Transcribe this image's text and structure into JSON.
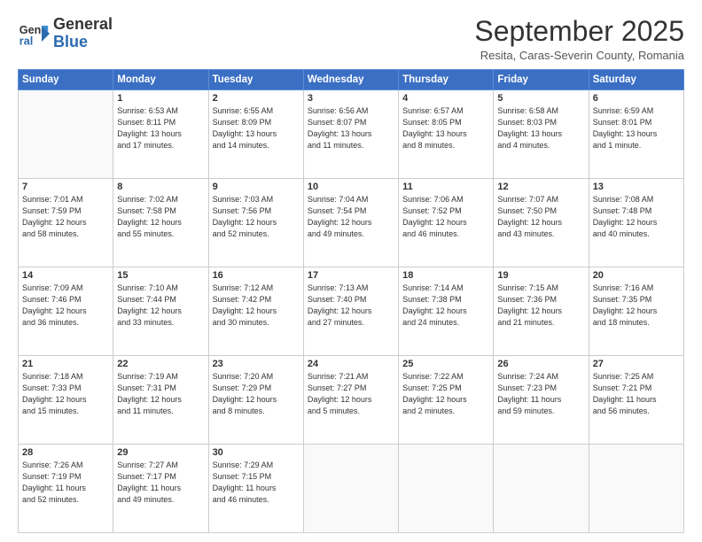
{
  "header": {
    "logo_general": "General",
    "logo_blue": "Blue",
    "month_title": "September 2025",
    "subtitle": "Resita, Caras-Severin County, Romania"
  },
  "days_of_week": [
    "Sunday",
    "Monday",
    "Tuesday",
    "Wednesday",
    "Thursday",
    "Friday",
    "Saturday"
  ],
  "weeks": [
    [
      {
        "day": "",
        "info": ""
      },
      {
        "day": "1",
        "info": "Sunrise: 6:53 AM\nSunset: 8:11 PM\nDaylight: 13 hours\nand 17 minutes."
      },
      {
        "day": "2",
        "info": "Sunrise: 6:55 AM\nSunset: 8:09 PM\nDaylight: 13 hours\nand 14 minutes."
      },
      {
        "day": "3",
        "info": "Sunrise: 6:56 AM\nSunset: 8:07 PM\nDaylight: 13 hours\nand 11 minutes."
      },
      {
        "day": "4",
        "info": "Sunrise: 6:57 AM\nSunset: 8:05 PM\nDaylight: 13 hours\nand 8 minutes."
      },
      {
        "day": "5",
        "info": "Sunrise: 6:58 AM\nSunset: 8:03 PM\nDaylight: 13 hours\nand 4 minutes."
      },
      {
        "day": "6",
        "info": "Sunrise: 6:59 AM\nSunset: 8:01 PM\nDaylight: 13 hours\nand 1 minute."
      }
    ],
    [
      {
        "day": "7",
        "info": "Sunrise: 7:01 AM\nSunset: 7:59 PM\nDaylight: 12 hours\nand 58 minutes."
      },
      {
        "day": "8",
        "info": "Sunrise: 7:02 AM\nSunset: 7:58 PM\nDaylight: 12 hours\nand 55 minutes."
      },
      {
        "day": "9",
        "info": "Sunrise: 7:03 AM\nSunset: 7:56 PM\nDaylight: 12 hours\nand 52 minutes."
      },
      {
        "day": "10",
        "info": "Sunrise: 7:04 AM\nSunset: 7:54 PM\nDaylight: 12 hours\nand 49 minutes."
      },
      {
        "day": "11",
        "info": "Sunrise: 7:06 AM\nSunset: 7:52 PM\nDaylight: 12 hours\nand 46 minutes."
      },
      {
        "day": "12",
        "info": "Sunrise: 7:07 AM\nSunset: 7:50 PM\nDaylight: 12 hours\nand 43 minutes."
      },
      {
        "day": "13",
        "info": "Sunrise: 7:08 AM\nSunset: 7:48 PM\nDaylight: 12 hours\nand 40 minutes."
      }
    ],
    [
      {
        "day": "14",
        "info": "Sunrise: 7:09 AM\nSunset: 7:46 PM\nDaylight: 12 hours\nand 36 minutes."
      },
      {
        "day": "15",
        "info": "Sunrise: 7:10 AM\nSunset: 7:44 PM\nDaylight: 12 hours\nand 33 minutes."
      },
      {
        "day": "16",
        "info": "Sunrise: 7:12 AM\nSunset: 7:42 PM\nDaylight: 12 hours\nand 30 minutes."
      },
      {
        "day": "17",
        "info": "Sunrise: 7:13 AM\nSunset: 7:40 PM\nDaylight: 12 hours\nand 27 minutes."
      },
      {
        "day": "18",
        "info": "Sunrise: 7:14 AM\nSunset: 7:38 PM\nDaylight: 12 hours\nand 24 minutes."
      },
      {
        "day": "19",
        "info": "Sunrise: 7:15 AM\nSunset: 7:36 PM\nDaylight: 12 hours\nand 21 minutes."
      },
      {
        "day": "20",
        "info": "Sunrise: 7:16 AM\nSunset: 7:35 PM\nDaylight: 12 hours\nand 18 minutes."
      }
    ],
    [
      {
        "day": "21",
        "info": "Sunrise: 7:18 AM\nSunset: 7:33 PM\nDaylight: 12 hours\nand 15 minutes."
      },
      {
        "day": "22",
        "info": "Sunrise: 7:19 AM\nSunset: 7:31 PM\nDaylight: 12 hours\nand 11 minutes."
      },
      {
        "day": "23",
        "info": "Sunrise: 7:20 AM\nSunset: 7:29 PM\nDaylight: 12 hours\nand 8 minutes."
      },
      {
        "day": "24",
        "info": "Sunrise: 7:21 AM\nSunset: 7:27 PM\nDaylight: 12 hours\nand 5 minutes."
      },
      {
        "day": "25",
        "info": "Sunrise: 7:22 AM\nSunset: 7:25 PM\nDaylight: 12 hours\nand 2 minutes."
      },
      {
        "day": "26",
        "info": "Sunrise: 7:24 AM\nSunset: 7:23 PM\nDaylight: 11 hours\nand 59 minutes."
      },
      {
        "day": "27",
        "info": "Sunrise: 7:25 AM\nSunset: 7:21 PM\nDaylight: 11 hours\nand 56 minutes."
      }
    ],
    [
      {
        "day": "28",
        "info": "Sunrise: 7:26 AM\nSunset: 7:19 PM\nDaylight: 11 hours\nand 52 minutes."
      },
      {
        "day": "29",
        "info": "Sunrise: 7:27 AM\nSunset: 7:17 PM\nDaylight: 11 hours\nand 49 minutes."
      },
      {
        "day": "30",
        "info": "Sunrise: 7:29 AM\nSunset: 7:15 PM\nDaylight: 11 hours\nand 46 minutes."
      },
      {
        "day": "",
        "info": ""
      },
      {
        "day": "",
        "info": ""
      },
      {
        "day": "",
        "info": ""
      },
      {
        "day": "",
        "info": ""
      }
    ]
  ]
}
